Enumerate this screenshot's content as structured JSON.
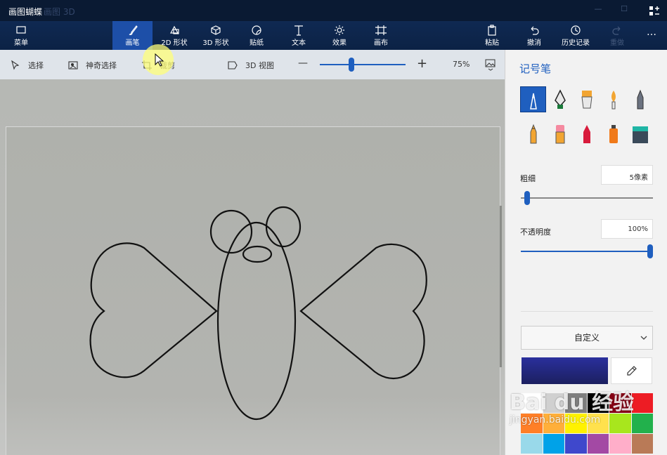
{
  "window": {
    "title": "画图蝴蝶",
    "app_name_ghost": "画图 3D"
  },
  "toolbar": {
    "menu_label": "菜单",
    "tools": [
      {
        "label": "画笔",
        "icon": "brush-icon",
        "active": true
      },
      {
        "label": "2D 形状",
        "icon": "shapes-2d-icon"
      },
      {
        "label": "3D 形状",
        "icon": "cube-icon"
      },
      {
        "label": "贴纸",
        "icon": "sticker-icon"
      },
      {
        "label": "文本",
        "icon": "text-icon"
      },
      {
        "label": "效果",
        "icon": "effects-icon"
      },
      {
        "label": "画布",
        "icon": "canvas-icon"
      }
    ],
    "paste_label": "粘贴",
    "undo_label": "撤消",
    "history_label": "历史记录",
    "redo_label": "重做",
    "more_label": "…"
  },
  "subbar": {
    "select_label": "选择",
    "magic_select_label": "神奇选择",
    "crop_label": "裁剪",
    "view3d_label": "3D 视图",
    "zoom_minus": "—",
    "zoom_plus": "+",
    "zoom_value": "75%",
    "zoom_level_fraction": 0.37
  },
  "panel": {
    "title": "记号笔",
    "brushes": [
      "marker-icon",
      "calligraphy-pen-icon",
      "oil-brush-icon",
      "watercolor-icon",
      "pixel-pen-icon",
      "pencil-icon",
      "eraser-icon",
      "crayon-icon",
      "spray-can-icon",
      "fill-bucket-icon"
    ],
    "thickness_label": "粗细",
    "thickness_value": "5像素",
    "thickness_fraction": 0.05,
    "opacity_label": "不透明度",
    "opacity_value": "100%",
    "opacity_fraction": 1.0,
    "color_mode": "自定义",
    "current_color": "#2a2f9c",
    "palette": [
      "#ffffff",
      "#d0d0d0",
      "#7f7f7f",
      "#000000",
      "#880015",
      "#ed1c24",
      "#ff7f27",
      "#ffaf3a",
      "#fff200",
      "#ffe14d",
      "#a8e61d",
      "#22b14c",
      "#99d9ea",
      "#00a2e8",
      "#3f48cc",
      "#a349a4",
      "#ffaec9",
      "#b97a57"
    ]
  },
  "watermark": {
    "brand": "Bai du 经验",
    "url": "jingyan.baidu.com"
  }
}
